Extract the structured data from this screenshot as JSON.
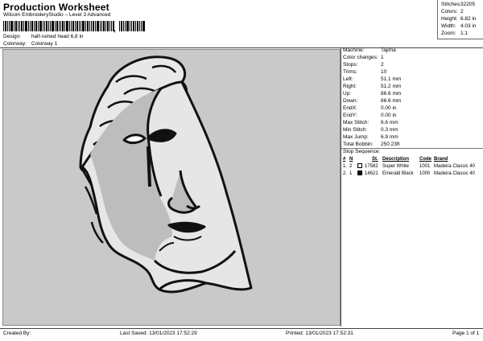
{
  "header": {
    "title": "Production Worksheet",
    "subtitle": "Wilcom EmbroideryStudio – Level 3 Advanced",
    "barcode_comma": ","
  },
  "design_info": {
    "design_label": "Design:",
    "design_value": "half-ruined head 6,8 in",
    "colorway_label": "Colorway:",
    "colorway_value": "Colorway 1"
  },
  "stats": {
    "stitches_label": "Stitches:",
    "stitches_value": "32205",
    "colors_label": "Colors:",
    "colors_value": "2",
    "height_label": "Height:",
    "height_value": "6.82 in",
    "width_label": "Width:",
    "width_value": "4.03 in",
    "zoom_label": "Zoom:",
    "zoom_value": "1:1"
  },
  "machine_info": [
    {
      "label": "Machine:",
      "value": "Tajima"
    },
    {
      "label": "Color changes:",
      "value": "1"
    },
    {
      "label": "Stops:",
      "value": "2"
    },
    {
      "label": "Trims:",
      "value": "10"
    },
    {
      "label": "Left:",
      "value": "51.1 mm"
    },
    {
      "label": "Right:",
      "value": "51.2 mm"
    },
    {
      "label": "Up:",
      "value": "86.6 mm"
    },
    {
      "label": "Down:",
      "value": "86.6 mm"
    },
    {
      "label": "EndX:",
      "value": "0.00 in"
    },
    {
      "label": "EndY:",
      "value": "0.00 in"
    },
    {
      "label": "Max Stitch:",
      "value": "6.6 mm"
    },
    {
      "label": "Min Stitch:",
      "value": "0.3 mm"
    },
    {
      "label": "Max Jump:",
      "value": "6.9 mm"
    },
    {
      "label": "Total Bobbin:",
      "value": "250.23ft"
    }
  ],
  "stop_sequence": {
    "title": "Stop Sequence:",
    "headers": {
      "num": "#",
      "n": "N",
      "st": "St.",
      "description": "Description",
      "code": "Code",
      "brand": "Brand"
    },
    "rows": [
      {
        "num": "1.",
        "n": "2",
        "color": "#f2f2f2",
        "st": "17582",
        "description": "Super White",
        "code": "1001",
        "brand": "Madeira Classic 40"
      },
      {
        "num": "2.",
        "n": "1",
        "color": "#111111",
        "st": "14621",
        "description": "Emerald Black",
        "code": "1000",
        "brand": "Madeira Classic 40"
      }
    ]
  },
  "footer": {
    "created_by": "Created By:",
    "last_saved": "Last Saved: 13/01/2023 17:52:29",
    "printed": "Printed: 13/01/2023 17:52:31",
    "page": "Page 1 of 1"
  },
  "colors": {
    "canvas_bg": "#c9c9c9",
    "thread_white": "#f2f2f2",
    "thread_black": "#111111"
  }
}
